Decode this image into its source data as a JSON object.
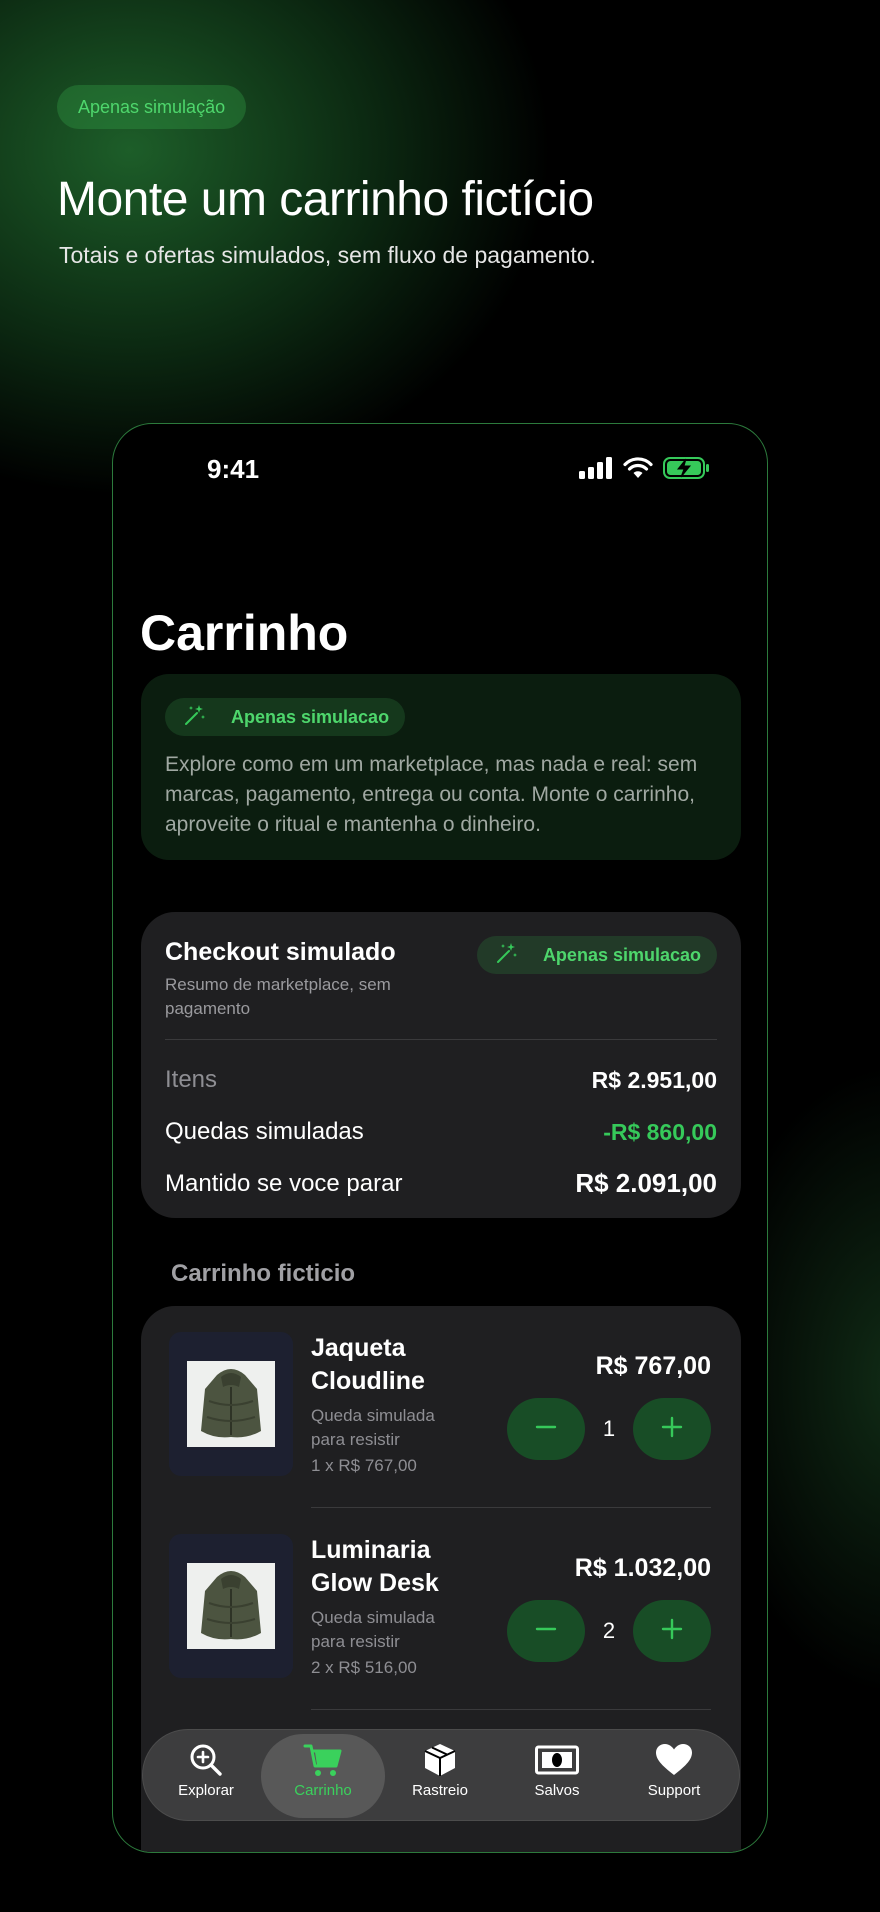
{
  "promo": {
    "pill": "Apenas simulação",
    "title": "Monte um carrinho fictício",
    "subtitle": "Totais e ofertas simulados, sem fluxo de pagamento."
  },
  "status_bar": {
    "time": "9:41"
  },
  "screen": {
    "title": "Carrinho",
    "intro": {
      "pill": "Apenas simulacao",
      "text": "Explore como em um marketplace, mas nada e real: sem marcas, pagamento, entrega ou conta. Monte o carrinho, aproveite o ritual e mantenha o dinheiro."
    },
    "checkout": {
      "title": "Checkout simulado",
      "subtitle": "Resumo de marketplace, sem pagamento",
      "pill": "Apenas simulacao",
      "rows": [
        {
          "label": "Itens",
          "value": "R$ 2.951,00"
        },
        {
          "label": "Quedas simuladas",
          "value": "-R$ 860,00"
        },
        {
          "label": "Mantido se voce parar",
          "value": "R$ 2.091,00"
        }
      ]
    },
    "cart_section_label": "Carrinho ficticio",
    "items": [
      {
        "name": "Jaqueta Cloudline",
        "sub": "Queda simulada para resistir",
        "unit": "1 x R$ 767,00",
        "price": "R$ 767,00",
        "qty": "1"
      },
      {
        "name": "Luminaria Glow Desk",
        "sub": "Queda simulada para resistir",
        "unit": "2 x R$ 516,00",
        "price": "R$ 1.032,00",
        "qty": "2"
      }
    ]
  },
  "tab_bar": {
    "active": "Carrinho",
    "tabs": [
      {
        "label": "Explorar",
        "icon": "magnifier-plus-icon"
      },
      {
        "label": "Carrinho",
        "icon": "cart-icon"
      },
      {
        "label": "Rastreio",
        "icon": "package-icon"
      },
      {
        "label": "Salvos",
        "icon": "banknote-icon"
      },
      {
        "label": "Support",
        "icon": "heart-icon"
      }
    ]
  },
  "colors": {
    "accent": "#36c95a",
    "card": "#1f1f21",
    "phone_border": "#2c7a3c"
  }
}
